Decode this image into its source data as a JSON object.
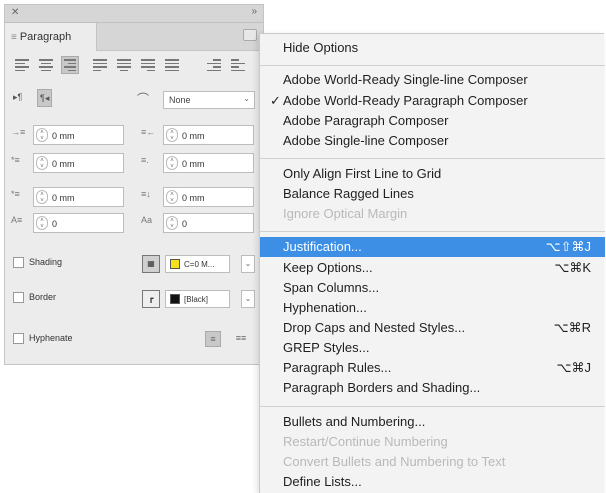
{
  "panel": {
    "tab_label": "Paragraph",
    "align_buttons": [
      {
        "name": "align-left-icon",
        "active": false
      },
      {
        "name": "align-center-icon",
        "active": false
      },
      {
        "name": "align-right-icon",
        "active": true
      },
      {
        "name": "justify-left-icon",
        "active": false
      },
      {
        "name": "justify-center-icon",
        "active": false
      },
      {
        "name": "justify-right-icon",
        "active": false
      },
      {
        "name": "justify-all-icon",
        "active": false
      },
      {
        "name": "align-toward-spine-icon",
        "active": false
      },
      {
        "name": "align-away-spine-icon",
        "active": false
      }
    ],
    "direction_ltr": "▸¶",
    "direction_rtl": "¶◂",
    "language_value": "None",
    "left_indent": "0 mm",
    "right_indent": "0 mm",
    "first_line_indent": "0 mm",
    "last_line_indent": "0 mm",
    "space_before": "0 mm",
    "space_after": "0 mm",
    "drop_cap_lines": "0",
    "drop_cap_chars": "0",
    "shading_label": "Shading",
    "shading_swatch": "C=0 M...",
    "shading_color": "#f5e21a",
    "border_label": "Border",
    "border_swatch": "[Black]",
    "border_color": "#111111",
    "hyphenate_label": "Hyphenate"
  },
  "menu": {
    "highlight_color": "#3d8fe6",
    "items": {
      "hide_options": "Hide Options",
      "world_ready_single": "Adobe World-Ready Single-line Composer",
      "world_ready_paragraph": "Adobe World-Ready Paragraph Composer",
      "world_ready_paragraph_check": "✓",
      "paragraph_composer": "Adobe Paragraph Composer",
      "single_line_composer": "Adobe Single-line Composer",
      "align_first_line": "Only Align First Line to Grid",
      "balance_ragged": "Balance Ragged Lines",
      "ignore_optical": "Ignore Optical Margin",
      "justification": "Justification...",
      "justification_sc": "⌥⇧⌘J",
      "keep_options": "Keep Options...",
      "keep_options_sc": "⌥⌘K",
      "span_columns": "Span Columns...",
      "hyphenation": "Hyphenation...",
      "drop_caps": "Drop Caps and Nested Styles...",
      "drop_caps_sc": "⌥⌘R",
      "grep_styles": "GREP Styles...",
      "paragraph_rules": "Paragraph Rules...",
      "paragraph_rules_sc": "⌥⌘J",
      "borders_shading": "Paragraph Borders and Shading...",
      "bullets_numbering": "Bullets and Numbering...",
      "restart_numbering": "Restart/Continue Numbering",
      "convert_bullets": "Convert Bullets and Numbering to Text",
      "define_lists": "Define Lists..."
    }
  }
}
